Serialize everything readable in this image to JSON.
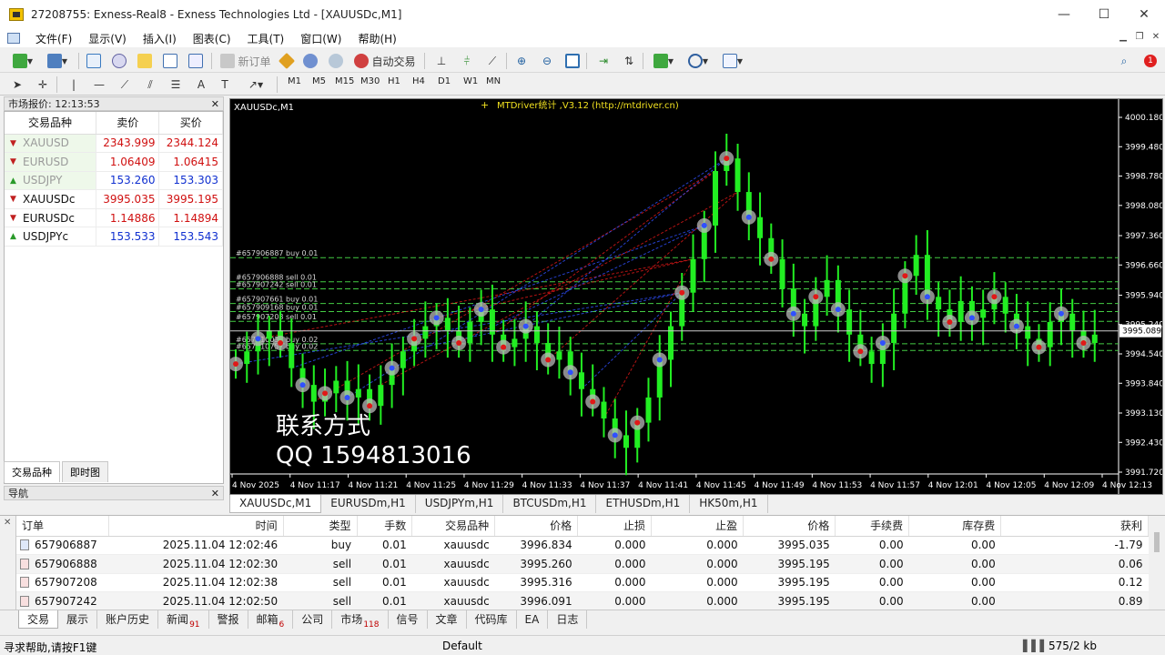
{
  "window": {
    "title": "27208755: Exness-Real8 - Exness Technologies Ltd - [XAUUSDc,M1]",
    "minimize": "—",
    "maximize": "☐",
    "close": "✕"
  },
  "menu": [
    "文件(F)",
    "显示(V)",
    "插入(I)",
    "图表(C)",
    "工具(T)",
    "窗口(W)",
    "帮助(H)"
  ],
  "toolbar": {
    "new_order": "新订单",
    "auto_trading": "自动交易",
    "timeframes": [
      "M1",
      "M5",
      "M15",
      "M30",
      "H1",
      "H4",
      "D1",
      "W1",
      "MN"
    ]
  },
  "market_watch": {
    "title": "市场报价: 12:13:53",
    "columns": [
      "交易品种",
      "卖价",
      "买价"
    ],
    "rows": [
      {
        "symbol": "XAUUSD",
        "bid": "2343.999",
        "ask": "2344.124",
        "dir": "down",
        "sym_color": "#9a9a9a",
        "val_color": "#d01010"
      },
      {
        "symbol": "EURUSD",
        "bid": "1.06409",
        "ask": "1.06415",
        "dir": "down",
        "sym_color": "#9a9a9a",
        "val_color": "#d01010"
      },
      {
        "symbol": "USDJPY",
        "bid": "153.260",
        "ask": "153.303",
        "dir": "up",
        "sym_color": "#9a9a9a",
        "val_color": "#1030d0"
      },
      {
        "symbol": "XAUUSDc",
        "bid": "3995.035",
        "ask": "3995.195",
        "dir": "down",
        "sym_color": "#111111",
        "val_color": "#d01010"
      },
      {
        "symbol": "EURUSDc",
        "bid": "1.14886",
        "ask": "1.14894",
        "dir": "down",
        "sym_color": "#111111",
        "val_color": "#d01010"
      },
      {
        "symbol": "USDJPYc",
        "bid": "153.533",
        "ask": "153.543",
        "dir": "up",
        "sym_color": "#111111",
        "val_color": "#1030d0"
      }
    ],
    "tabs": [
      "交易品种",
      "即时图"
    ]
  },
  "navigator": {
    "title": "导航"
  },
  "chart": {
    "symbol_label": "XAUUSDc,M1",
    "indicator_label": "MTDriver统计 ,V3.12 (http://mtdriver.cn)",
    "contact_line1": "联系方式",
    "contact_line2": "QQ 1594813016",
    "current_price": "3995.089",
    "colors": {
      "candle": "#22ee22",
      "grid_line": "#44cc44",
      "buy_line": "#3050ff",
      "sell_line": "#e01818"
    }
  },
  "chart_data": {
    "type": "candlestick",
    "title": "XAUUSDc,M1",
    "y_ticks": [
      "4000.180",
      "3999.480",
      "3998.780",
      "3998.080",
      "3997.360",
      "3996.660",
      "3995.940",
      "3995.240",
      "3994.540",
      "3993.840",
      "3993.130",
      "3992.430",
      "3991.720"
    ],
    "x_ticks": [
      "4 Nov 2025",
      "4 Nov 11:17",
      "4 Nov 11:21",
      "4 Nov 11:25",
      "4 Nov 11:29",
      "4 Nov 11:33",
      "4 Nov 11:37",
      "4 Nov 11:41",
      "4 Nov 11:45",
      "4 Nov 11:49",
      "4 Nov 11:53",
      "4 Nov 11:57",
      "4 Nov 12:01",
      "4 Nov 12:05",
      "4 Nov 12:09",
      "4 Nov 12:13"
    ],
    "ylim": [
      3991.72,
      4000.18
    ],
    "order_lines": [
      {
        "label": "#657906887 buy 0.01",
        "price": 3996.834
      },
      {
        "label": "#657906888 sell 0.01",
        "price": 3996.26
      },
      {
        "label": "#657907242 sell 0.01",
        "price": 3996.091
      },
      {
        "label": "#657907661 buy 0.01",
        "price": 3995.74
      },
      {
        "label": "#657909168 buy 0.01",
        "price": 3995.55
      },
      {
        "label": "#657907208 sell 0.01",
        "price": 3995.316
      },
      {
        "label": "#657910031 buy 0.02",
        "price": 3994.78
      },
      {
        "label": "#657910757 buy 0.02",
        "price": 3994.62
      }
    ],
    "candles": [
      3994.3,
      3994.6,
      3994.9,
      3995.1,
      3994.8,
      3994.2,
      3993.8,
      3993.4,
      3993.6,
      3993.9,
      3993.5,
      3993.7,
      3993.3,
      3993.8,
      3994.2,
      3994.6,
      3994.9,
      3995.2,
      3995.4,
      3995.1,
      3994.8,
      3995.3,
      3995.6,
      3995.0,
      3994.7,
      3994.9,
      3995.2,
      3994.8,
      3994.4,
      3994.6,
      3994.1,
      3993.7,
      3993.4,
      3993.0,
      3992.6,
      3992.3,
      3992.9,
      3993.5,
      3994.4,
      3995.2,
      3996.0,
      3996.8,
      3997.6,
      3998.9,
      3999.2,
      3998.4,
      3997.8,
      3997.3,
      3996.8,
      3996.1,
      3995.5,
      3995.2,
      3995.9,
      3996.3,
      3995.6,
      3995.0,
      3994.6,
      3994.3,
      3994.8,
      3995.5,
      3996.4,
      3996.9,
      3995.9,
      3995.6,
      3995.3,
      3995.8,
      3995.4,
      3995.6,
      3995.9,
      3995.5,
      3995.2,
      3994.9,
      3994.7,
      3995.3,
      3995.5,
      3995.1,
      3994.8,
      3995.0
    ]
  },
  "chart_tabs": [
    "XAUUSDc,M1",
    "EURUSDm,H1",
    "USDJPYm,H1",
    "BTCUSDm,H1",
    "ETHUSDm,H1",
    "HK50m,H1"
  ],
  "orders": {
    "columns": [
      "订单",
      "时间",
      "类型",
      "手数",
      "交易品种",
      "价格",
      "止损",
      "止盈",
      "价格",
      "手续费",
      "库存费",
      "获利"
    ],
    "rows": [
      [
        "657906887",
        "2025.11.04 12:02:46",
        "buy",
        "0.01",
        "xauusdc",
        "3996.834",
        "0.000",
        "0.000",
        "3995.035",
        "0.00",
        "0.00",
        "-1.79"
      ],
      [
        "657906888",
        "2025.11.04 12:02:30",
        "sell",
        "0.01",
        "xauusdc",
        "3995.260",
        "0.000",
        "0.000",
        "3995.195",
        "0.00",
        "0.00",
        "0.06"
      ],
      [
        "657907208",
        "2025.11.04 12:02:38",
        "sell",
        "0.01",
        "xauusdc",
        "3995.316",
        "0.000",
        "0.000",
        "3995.195",
        "0.00",
        "0.00",
        "0.12"
      ],
      [
        "657907242",
        "2025.11.04 12:02:50",
        "sell",
        "0.01",
        "xauusdc",
        "3996.091",
        "0.000",
        "0.000",
        "3995.195",
        "0.00",
        "0.00",
        "0.89"
      ]
    ]
  },
  "terminal_tabs": [
    {
      "label": "交易",
      "badge": ""
    },
    {
      "label": "展示",
      "badge": ""
    },
    {
      "label": "账户历史",
      "badge": ""
    },
    {
      "label": "新闻",
      "badge": "91"
    },
    {
      "label": "警报",
      "badge": ""
    },
    {
      "label": "邮箱",
      "badge": "6"
    },
    {
      "label": "公司",
      "badge": ""
    },
    {
      "label": "市场",
      "badge": "118"
    },
    {
      "label": "信号",
      "badge": ""
    },
    {
      "label": "文章",
      "badge": ""
    },
    {
      "label": "代码库",
      "badge": ""
    },
    {
      "label": "EA",
      "badge": ""
    },
    {
      "label": "日志",
      "badge": ""
    }
  ],
  "status": {
    "help": "寻求帮助,请按F1键",
    "profile": "Default",
    "traffic": "575/2 kb"
  }
}
